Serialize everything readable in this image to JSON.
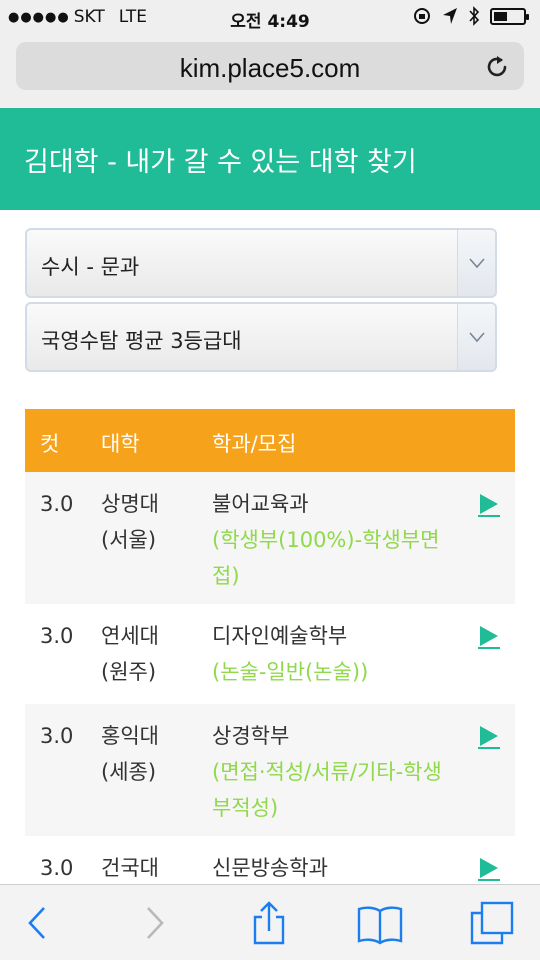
{
  "status_bar": {
    "signal": "●●●●●",
    "carrier": "SKT",
    "network": "LTE",
    "time": "오전 4:49",
    "battery_level": 0.45
  },
  "browser": {
    "url": "kim.place5.com"
  },
  "header": {
    "title": "김대학 - 내가 갈 수 있는 대학 찾기"
  },
  "filters": {
    "admission_type": "수시 - 문과",
    "grade_level": "국영수탐 평균 3등급대"
  },
  "table": {
    "headers": {
      "cut": "컷",
      "university": "대학",
      "department": "학과/모집"
    },
    "rows": [
      {
        "cut": "3.0",
        "univ_name": "상명대",
        "univ_campus": "(서울)",
        "dept": "불어교육과",
        "method": "(학생부(100%)-학생부면접)"
      },
      {
        "cut": "3.0",
        "univ_name": "연세대",
        "univ_campus": "(원주)",
        "dept": "디자인예술학부",
        "method": "(논술-일반(논술))"
      },
      {
        "cut": "3.0",
        "univ_name": "홍익대",
        "univ_campus": "(세종)",
        "dept": "상경학부",
        "method": "(면접·적성/서류/기타-학생부적성)"
      },
      {
        "cut": "3.0",
        "univ_name": "건국대",
        "univ_campus": "",
        "dept": "신문방송학과",
        "method": ""
      }
    ]
  },
  "colors": {
    "header_bg": "#1fbc97",
    "table_header_bg": "#f7a21b",
    "method_text": "#8fd94a",
    "play_icon": "#1fbc97",
    "toolbar_icon": "#1a7ef0"
  }
}
